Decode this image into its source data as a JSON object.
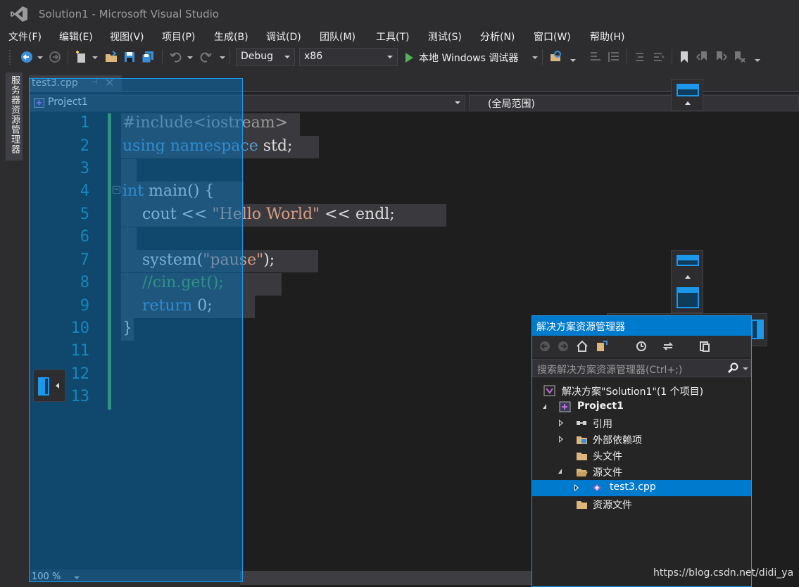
{
  "window": {
    "title": "Solution1 - Microsoft Visual Studio"
  },
  "menu": [
    "文件(F)",
    "编辑(E)",
    "视图(V)",
    "项目(P)",
    "生成(B)",
    "调试(D)",
    "团队(M)",
    "工具(T)",
    "测试(S)",
    "分析(N)",
    "窗口(W)",
    "帮助(H)"
  ],
  "toolbar": {
    "config": "Debug",
    "platform": "x86",
    "run_label": "本地 Windows 调试器"
  },
  "side_tab": {
    "label": "服务器资源管理器"
  },
  "editor": {
    "tab": {
      "label": "test3.cpp",
      "pin": "⊣",
      "close": "✕"
    },
    "nav": {
      "project": "Project1",
      "scope": "(全局范围)"
    },
    "line_numbers": [
      "1",
      "2",
      "3",
      "4",
      "5",
      "6",
      "7",
      "8",
      "9",
      "10",
      "11",
      "12",
      "13"
    ],
    "code": {
      "l1": "#include<iostream>",
      "l2a": "using namespace",
      "l2b": " std;",
      "l4a": "int",
      "l4b": " main() {",
      "l5a": "    cout << ",
      "l5b": "\"Hello World\"",
      "l5c": " << endl;",
      "l7a": "    system(",
      "l7b": "\"pause\"",
      "l7c": ");",
      "l8": "    //cin.get();",
      "l9a": "    return",
      "l9b": " 0;",
      "l10": "}",
      "fold": "−"
    },
    "zoom": "100 %"
  },
  "solution_explorer": {
    "title": "解决方案资源管理器",
    "search_placeholder": "搜索解决方案资源管理器(Ctrl+;)",
    "tree": {
      "solution": "解决方案\"Solution1\"(1 个项目)",
      "project": "Project1",
      "references": "引用",
      "external": "外部依赖项",
      "headers": "头文件",
      "sources": "源文件",
      "file": "test3.cpp",
      "resources": "资源文件"
    }
  },
  "watermark": "https://blog.csdn.net/didi_ya",
  "colors": {
    "accent": "#007acc",
    "keyword": "#569cd6",
    "string": "#d69d85",
    "comment": "#57a64a",
    "line_number": "#2b91af"
  }
}
